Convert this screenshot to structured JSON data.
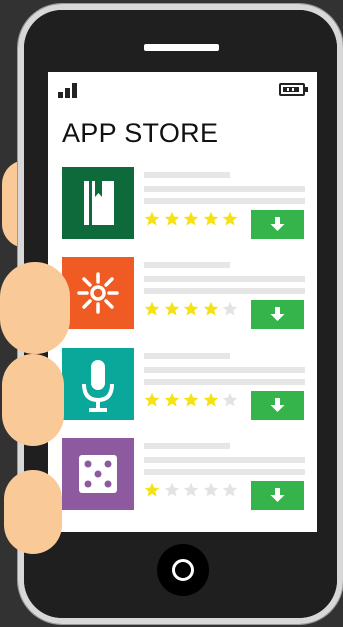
{
  "screen": {
    "title": "APP STORE",
    "status": {
      "signal_icon": "signal-icon",
      "battery_icon": "battery-icon"
    }
  },
  "apps": [
    {
      "icon": "book-icon",
      "icon_bg": "#0e6a3a",
      "rating": 5,
      "max_rating": 5,
      "action": "download"
    },
    {
      "icon": "sparkle-icon",
      "icon_bg": "#f05a23",
      "rating": 4,
      "max_rating": 5,
      "action": "download"
    },
    {
      "icon": "microphone-icon",
      "icon_bg": "#0aa89a",
      "rating": 4,
      "max_rating": 5,
      "action": "download"
    },
    {
      "icon": "dice-icon",
      "icon_bg": "#8e5a9f",
      "rating": 1,
      "max_rating": 5,
      "action": "download"
    }
  ],
  "colors": {
    "star_filled": "#f5e214",
    "star_empty": "#e3e3e3",
    "download_button": "#34b44a",
    "skin": "#f9c998"
  }
}
